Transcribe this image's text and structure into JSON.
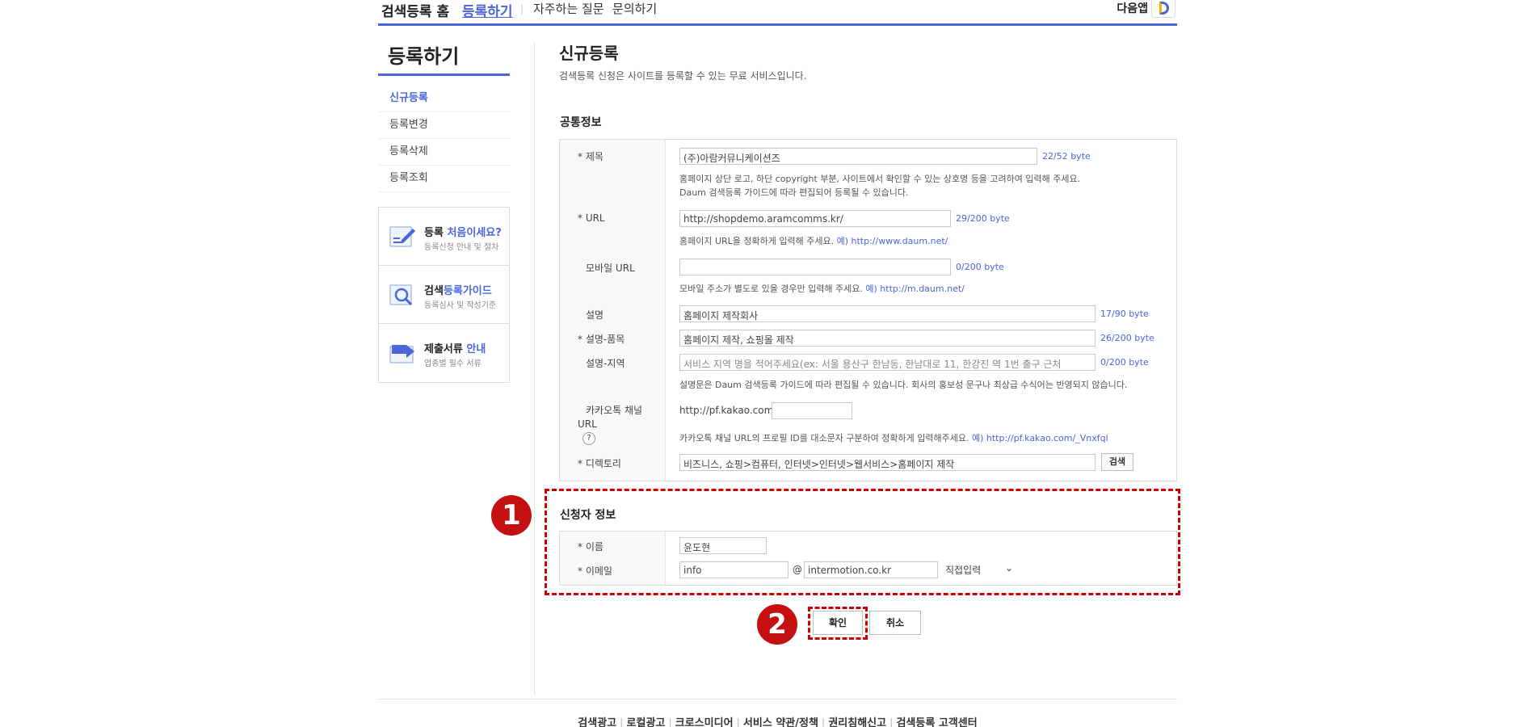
{
  "topnav": {
    "home": "검색등록 홈",
    "register": "등록하기",
    "faq": "자주하는 질문",
    "ask": "문의하기",
    "daum_app": "다음앱"
  },
  "sidebar": {
    "title": "등록하기",
    "items": [
      {
        "label": "신규등록"
      },
      {
        "label": "등록변경"
      },
      {
        "label": "등록삭제"
      },
      {
        "label": "등록조회"
      }
    ],
    "boxes": [
      {
        "title_a": "등록 ",
        "title_b": "처음이세요?",
        "sub": "등록신청 안내 및 절차",
        "icon": "pencil-doc-icon"
      },
      {
        "title_a": "검색",
        "title_b": "등록가이드",
        "sub": "등록심사 및 작성기준",
        "icon": "magnifier-doc-icon"
      },
      {
        "title_a": "제출서류 ",
        "title_b": "안내",
        "sub": "업종별 필수 서류",
        "icon": "folder-arrow-icon"
      }
    ]
  },
  "main": {
    "title": "신규등록",
    "desc": "검색등록 신청은 사이트를 등록할 수 있는 무료 서비스입니다.",
    "common_section": "공통정보",
    "fields": {
      "title_label": "* 제목",
      "title_value": "(주)아람커뮤니케이션즈",
      "title_count": "22/52 byte",
      "title_hint1": "홈페이지 상단 로고, 하단 copyright 부분, 사이트에서 확인할 수 있는 상호명 등을 고려하여 입력해 주세요.",
      "title_hint2": "Daum 검색등록 가이드에 따라 편집되어 등록될 수 있습니다.",
      "url_label": "* URL",
      "url_value": "http://shopdemo.aramcomms.kr/",
      "url_count": "29/200 byte",
      "url_hint": "홈페이지 URL을 정확하게 입력해 주세요. ",
      "url_example": "예) http://www.daum.net/",
      "mobile_label": "모바일 URL",
      "mobile_value": "",
      "mobile_count": "0/200 byte",
      "mobile_hint": "모바일 주소가 별도로 있을 경우만 입력해 주세요. ",
      "mobile_example": "예) http://m.daum.net/",
      "desc_label": "설명",
      "desc_value": "홈페이지 제작회사",
      "desc_count": "17/90 byte",
      "desc_item_label": "* 설명-품목",
      "desc_item_value": "홈페이지 제작, 쇼핑몰 제작",
      "desc_item_count": "26/200 byte",
      "desc_region_label": "설명-지역",
      "desc_region_placeholder": "서비스 지역 명을 적어주세요(ex: 서울 용산구 한남동, 한남대로 11, 한강진 역 1번 출구 근처",
      "desc_region_count": "0/200 byte",
      "desc_hint": "설명문은 Daum 검색등록 가이드에 따라 편집될 수 있습니다. 회사의 홍보성 문구나 최상급 수식어는 반영되지 않습니다.",
      "kakao_label1": "카카오톡 채널",
      "kakao_label2": "URL",
      "kakao_qmark": "?",
      "kakao_prefix": "http://pf.kakao.com/",
      "kakao_value": "",
      "kakao_hint": "카카오톡 채널 URL의 프로필 ID를 대소문자 구분하여 정확하게 입력해주세요. ",
      "kakao_example": "예) http://pf.kakao.com/_Vnxfql",
      "dir_label": "* 디렉토리",
      "dir_value": "비즈니스, 쇼핑>컴퓨터, 인터넷>인터넷>웹서비스>홈페이지 제작",
      "dir_button": "검색"
    },
    "applicant_section": "신청자 정보",
    "applicant": {
      "name_label": "* 이름",
      "name_value": "윤도현",
      "email_label": "* 이메일",
      "email_id": "info",
      "at": "@",
      "email_domain": "intermotion.co.kr",
      "domain_select": "직접입력"
    },
    "badges": [
      "1",
      "2"
    ],
    "confirm_button": "확인",
    "cancel_button": "취소"
  },
  "footer": {
    "links": [
      "검색광고",
      "로컬광고",
      "크로스미디어",
      "서비스 약관/정책",
      "권리침해신고",
      "검색등록 고객센터"
    ]
  }
}
